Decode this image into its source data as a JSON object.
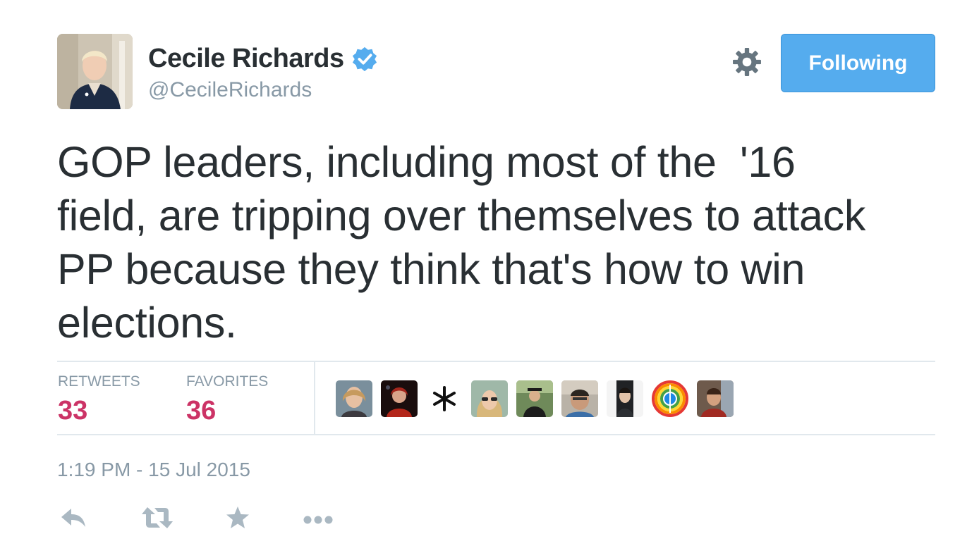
{
  "user": {
    "name": "Cecile Richards",
    "handle": "@CecileRichards",
    "verified": true
  },
  "follow_button": {
    "label": "Following"
  },
  "tweet": {
    "text": "GOP leaders, including most of the  '16\nfield, are tripping over themselves to attack\nPP because they think that's how to win\nelections."
  },
  "stats": {
    "retweets_label": "RETWEETS",
    "retweets_count": "33",
    "favorites_label": "FAVORITES",
    "favorites_count": "36"
  },
  "favoriters": [
    {
      "icon": "avatar-woman-blonde"
    },
    {
      "icon": "avatar-woman-red-dark"
    },
    {
      "icon": "avatar-asterisk"
    },
    {
      "icon": "avatar-woman-sunglasses"
    },
    {
      "icon": "avatar-graduate"
    },
    {
      "icon": "avatar-man-glasses"
    },
    {
      "icon": "avatar-man-dark"
    },
    {
      "icon": "avatar-rainbow-peace"
    },
    {
      "icon": "avatar-man-red"
    }
  ],
  "timestamp": "1:19 PM - 15 Jul 2015",
  "actions": [
    "reply-icon",
    "retweet-icon",
    "favorite-icon",
    "more-icon"
  ],
  "colors": {
    "accent": "#55acee",
    "count": "#cc3366",
    "muted": "#8899a6",
    "text": "#292f33",
    "divider": "#e1e8ed"
  }
}
